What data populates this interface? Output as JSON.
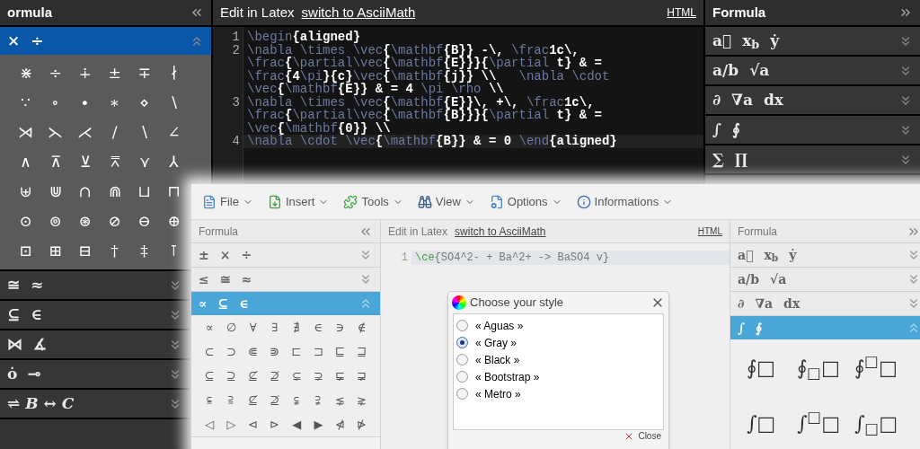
{
  "back_window": {
    "left_panel": {
      "title": "ormula",
      "sections": [
        {
          "symbols": [
            "×",
            "÷"
          ],
          "expanded": true,
          "grid": [
            [
              "⋇",
              "÷",
              "∔",
              "±",
              "∓",
              "∤"
            ],
            [
              "∵",
              "∘",
              "∙",
              "∗",
              "⋄",
              "∖"
            ],
            [
              "⋊",
              "⋋",
              "⋌",
              "∕",
              "∖",
              "∠"
            ],
            [
              "∧",
              "⊼",
              "⊻",
              "⩞",
              "⋎",
              "⅄"
            ],
            [
              "⊎",
              "⋓",
              "∩",
              "⋒",
              "⊔",
              "⊓"
            ],
            [
              "⊙",
              "⊚",
              "⊛",
              "⊘",
              "⊖",
              "⊕"
            ],
            [
              "⊡",
              "⊞",
              "⊟",
              "†",
              "‡",
              "⊺"
            ]
          ]
        },
        {
          "symbols": [
            "≅",
            "≈"
          ],
          "expanded": false
        },
        {
          "symbols": [
            "⊆",
            "∈"
          ],
          "expanded": false
        },
        {
          "symbols": [
            "⋈",
            "∡"
          ],
          "expanded": false
        },
        {
          "symbols": [
            "ȯ",
            "⊸"
          ],
          "expanded": false
        },
        {
          "symbols": [
            "⇌ *B* ↔ *C*"
          ],
          "expanded": false
        }
      ]
    },
    "editor": {
      "title": "Edit in Latex",
      "link": "switch to AsciiMath",
      "html_link": "HTML",
      "lines": [
        {
          "number": "1",
          "current": false,
          "segments": [
            "\\begin{aligned}"
          ]
        },
        {
          "number": "2",
          "current": false,
          "segments": [
            "\\nabla \\times \\vec{\\mathbf{B}} -\\, \\frac1c\\,",
            "\\frac{\\partial\\vec{\\mathbf{E}}}{\\partial t} & =",
            "\\frac{4\\pi}{c}\\vec{\\mathbf{j}} \\\\   \\nabla \\cdot",
            "\\vec{\\mathbf{E}} & = 4 \\pi \\rho \\\\"
          ]
        },
        {
          "number": "3",
          "current": false,
          "segments": [
            "\\nabla \\times \\vec{\\mathbf{E}}\\, +\\, \\frac1c\\,",
            "\\frac{\\partial\\vec{\\mathbf{B}}}{\\partial t} & =",
            "\\vec{\\mathbf{0}} \\\\"
          ]
        },
        {
          "number": "4",
          "current": true,
          "segments": [
            "\\nabla \\cdot \\vec{\\mathbf{B}} & = 0 \\end{aligned}"
          ]
        }
      ]
    },
    "right_panel": {
      "title": "Formula",
      "sections": [
        {
          "symbols": [
            "a⃗",
            "x$_{b}$",
            "ẏ"
          ],
          "expanded": false
        },
        {
          "symbols": [
            "a/b",
            "√a"
          ],
          "expanded": false
        },
        {
          "symbols": [
            "∂",
            "∇a",
            "dx"
          ],
          "expanded": false
        },
        {
          "symbols": [
            "∫",
            "∮"
          ],
          "expanded": false
        },
        {
          "symbols": [
            "∑",
            "∏"
          ],
          "expanded": false
        }
      ]
    }
  },
  "front_window": {
    "menu": [
      {
        "label": "File",
        "kind": "file"
      },
      {
        "label": "Insert",
        "kind": "insert"
      },
      {
        "label": "Tools",
        "kind": "tools"
      },
      {
        "label": "View",
        "kind": "view"
      },
      {
        "label": "Options",
        "kind": "options"
      },
      {
        "label": "Informations",
        "kind": "info"
      }
    ],
    "left_panel": {
      "title": "Formula",
      "sections": [
        {
          "symbols": [
            "±",
            "×",
            "÷"
          ],
          "expanded": false
        },
        {
          "symbols": [
            "≤",
            "≅",
            "≈"
          ],
          "expanded": false
        },
        {
          "symbols": [
            "∝",
            "⊆",
            "∈"
          ],
          "expanded": true,
          "grid": [
            [
              "∝",
              "∅",
              "∀",
              "∃",
              "∄",
              "∈",
              "∋",
              "∉"
            ],
            [
              "⊂",
              "⊃",
              "⋐",
              "⋑",
              "⊏",
              "⊐",
              "⊑",
              "⊒"
            ],
            [
              "⊆",
              "⊇",
              "⊈",
              "⊉",
              "⊊",
              "⊋",
              "⋤",
              "⋥"
            ],
            [
              "⫅",
              "⫆",
              "⊈",
              "⊉",
              "⫋",
              "⫌",
              "⋦",
              "⋧"
            ],
            [
              "◁",
              "▷",
              "⊲",
              "⊳",
              "◀",
              "▶",
              "⋪",
              "⋫"
            ]
          ]
        }
      ]
    },
    "editor": {
      "title": "Edit in Latex",
      "link": "switch to AsciiMath",
      "html_link": "HTML",
      "lines": [
        {
          "number": "1",
          "current": true,
          "segments": [
            "\\ce{SO4^2- + Ba^2+ -> BaSO4 v}"
          ]
        }
      ],
      "dialog": {
        "title": "Choose your style",
        "options": [
          {
            "label": "« Aguas »",
            "selected": false
          },
          {
            "label": "« Gray »",
            "selected": true
          },
          {
            "label": "« Black »",
            "selected": false
          },
          {
            "label": "« Bootstrap »",
            "selected": false
          },
          {
            "label": "« Metro »",
            "selected": false
          }
        ],
        "close_label": "Close"
      }
    },
    "right_panel": {
      "title": "Formula",
      "sections": [
        {
          "symbols": [
            "a⃗",
            "x$_{b}$",
            "ẏ"
          ],
          "expanded": false
        },
        {
          "symbols": [
            "a/b",
            "√a"
          ],
          "expanded": false
        },
        {
          "symbols": [
            "∂",
            "∇a",
            "dx"
          ],
          "expanded": false
        },
        {
          "symbols": [
            "∫",
            "∮"
          ],
          "expanded": true,
          "grid": [
            [
              "∮□",
              "∮$_{□}$□",
              "∮$^{□}$□"
            ],
            [
              "∫□",
              "∫$^{□}$□",
              "∫$_{□}$□"
            ]
          ]
        }
      ]
    }
  }
}
